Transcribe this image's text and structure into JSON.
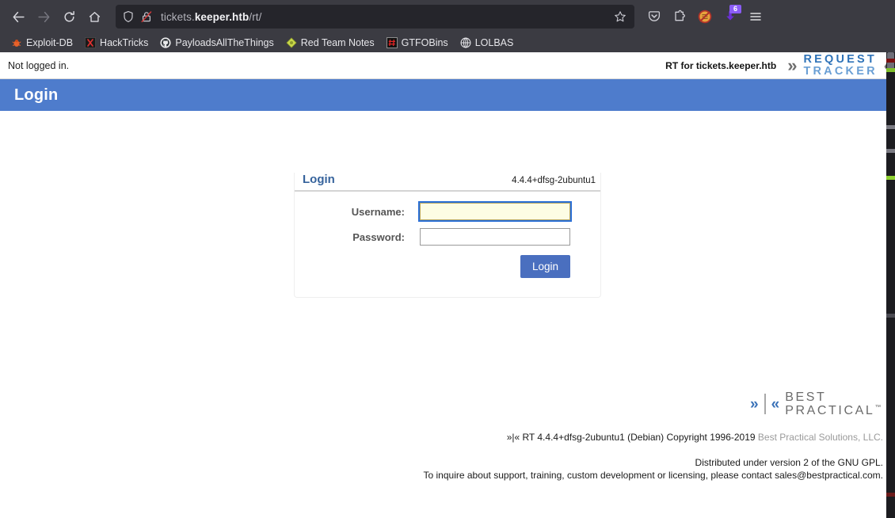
{
  "browser": {
    "nav": {
      "back_label": "Back",
      "forward_label": "Forward",
      "reload_label": "Reload",
      "home_label": "Home"
    },
    "urlbar": {
      "shield_icon": "shield-icon",
      "lock_icon": "lock-crossed-icon",
      "url_prefix": "tickets.",
      "url_host": "keeper.htb",
      "url_path": "/rt/",
      "full_url": "tickets.keeper.htb/rt/",
      "bookmark_icon": "star-icon"
    },
    "toolbar_icons": [
      {
        "name": "pocket-icon",
        "glyph": "pocket"
      },
      {
        "name": "extensions-icon",
        "glyph": "extensions"
      },
      {
        "name": "noscript-icon",
        "glyph": "noscript"
      },
      {
        "name": "downloads-icon",
        "glyph": "download",
        "badge": "6"
      },
      {
        "name": "app-menu-icon",
        "glyph": "hamburger"
      }
    ],
    "bookmarks": [
      {
        "label": "Exploit-DB",
        "icon": "bug-icon"
      },
      {
        "label": "HackTricks",
        "icon": "hacktricks-icon"
      },
      {
        "label": "PayloadsAllTheThings",
        "icon": "github-icon"
      },
      {
        "label": "Red Team Notes",
        "icon": "diamond-icon"
      },
      {
        "label": "GTFOBins",
        "icon": "hash-icon"
      },
      {
        "label": "LOLBAS",
        "icon": "globe-icon"
      }
    ]
  },
  "rt": {
    "status": "Not logged in.",
    "instance_label": "RT for tickets.keeper.htb",
    "logo": {
      "left_chevron": "»",
      "right_chevron": "«",
      "line1": "REQUEST",
      "line2": "TRACKER"
    },
    "page_title": "Login",
    "form": {
      "box_title": "Login",
      "version": "4.4.4+dfsg-2ubuntu1",
      "username_label": "Username:",
      "username_value": "",
      "username_placeholder": "",
      "password_label": "Password:",
      "password_value": "",
      "password_placeholder": "",
      "submit_label": "Login"
    },
    "footer": {
      "brand_chevron_left": "»",
      "brand_chevron_right": "«",
      "brand_line1": "BEST",
      "brand_line2": "PRACTICAL",
      "brand_tm": "™",
      "copyright_prefix": "»|« RT 4.4.4+dfsg-2ubuntu1 (Debian) Copyright 1996-2019 ",
      "copyright_company": "Best Practical Solutions, LLC.",
      "license_line": "Distributed under version 2 of the GNU GPL.",
      "contact_line": "To inquire about support, training, custom development or licensing, please contact sales@bestpractical.com."
    }
  },
  "colors": {
    "rt_header_blue": "#4e7ccc",
    "rt_link_blue": "#36639c",
    "login_button_blue": "#4a6fbf",
    "focus_ring_blue": "#2a6fd6",
    "focused_field_bg": "#fdfde4",
    "chrome_bg": "#3b3b42",
    "urlbar_bg": "#25252b"
  }
}
